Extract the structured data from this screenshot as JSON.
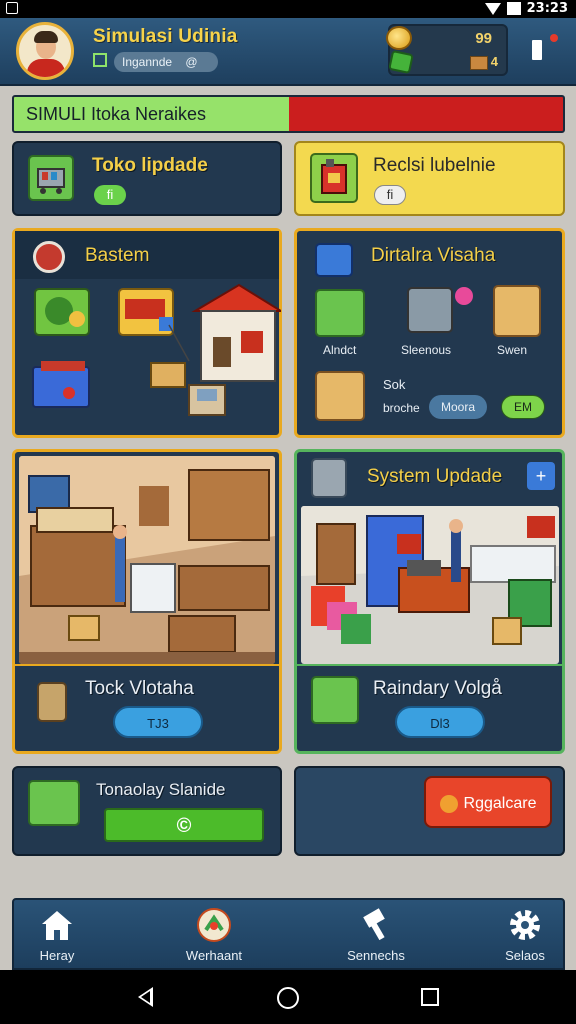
{
  "status_bar": {
    "time": "23:23"
  },
  "header": {
    "title": "Simulasi Udinia",
    "subtitle": "Ingannde",
    "subtitle_suffix": "@",
    "coins": "99",
    "boxes": "4"
  },
  "progress": {
    "label": "SIMULI Itoka Neraikes",
    "value_fraction": 0.5
  },
  "cards": {
    "toko_update": {
      "title": "Toko lipdade",
      "badge": "fi"
    },
    "reclsi": {
      "title": "Reclsi lubelnie",
      "badge": "fi"
    },
    "bastem": {
      "title": "Bastem"
    },
    "dirtalra": {
      "title": "Dirtalra Visaha",
      "items": [
        "Alndct",
        "Sleenous",
        "Swen"
      ],
      "sok_label": "Sok",
      "sub_label": "broche",
      "pill": "Moora",
      "pill2": "EM"
    },
    "tock_vlotaha": {
      "title": "Tock Vlotaha",
      "button": "TJ3"
    },
    "system_update": {
      "title": "System Updade",
      "badge": "+"
    },
    "raindary": {
      "title": "Raindary Volgå",
      "button": "Dl3"
    },
    "tonaclay": {
      "title": "Tonaolay Slanide",
      "button": "©"
    },
    "regalcare": {
      "button": "Rggalcare"
    }
  },
  "nav": [
    {
      "label": "Heray",
      "icon": "home-icon"
    },
    {
      "label": "Werhaant",
      "icon": "wheel-icon"
    },
    {
      "label": "Sennechs",
      "icon": "hammer-icon"
    },
    {
      "label": "Selaos",
      "icon": "gear-icon"
    }
  ],
  "colors": {
    "accent_gold": "#e9a91f",
    "progress_green": "#96e26a",
    "progress_red": "#cb1e1e",
    "navy": "#22384f"
  }
}
